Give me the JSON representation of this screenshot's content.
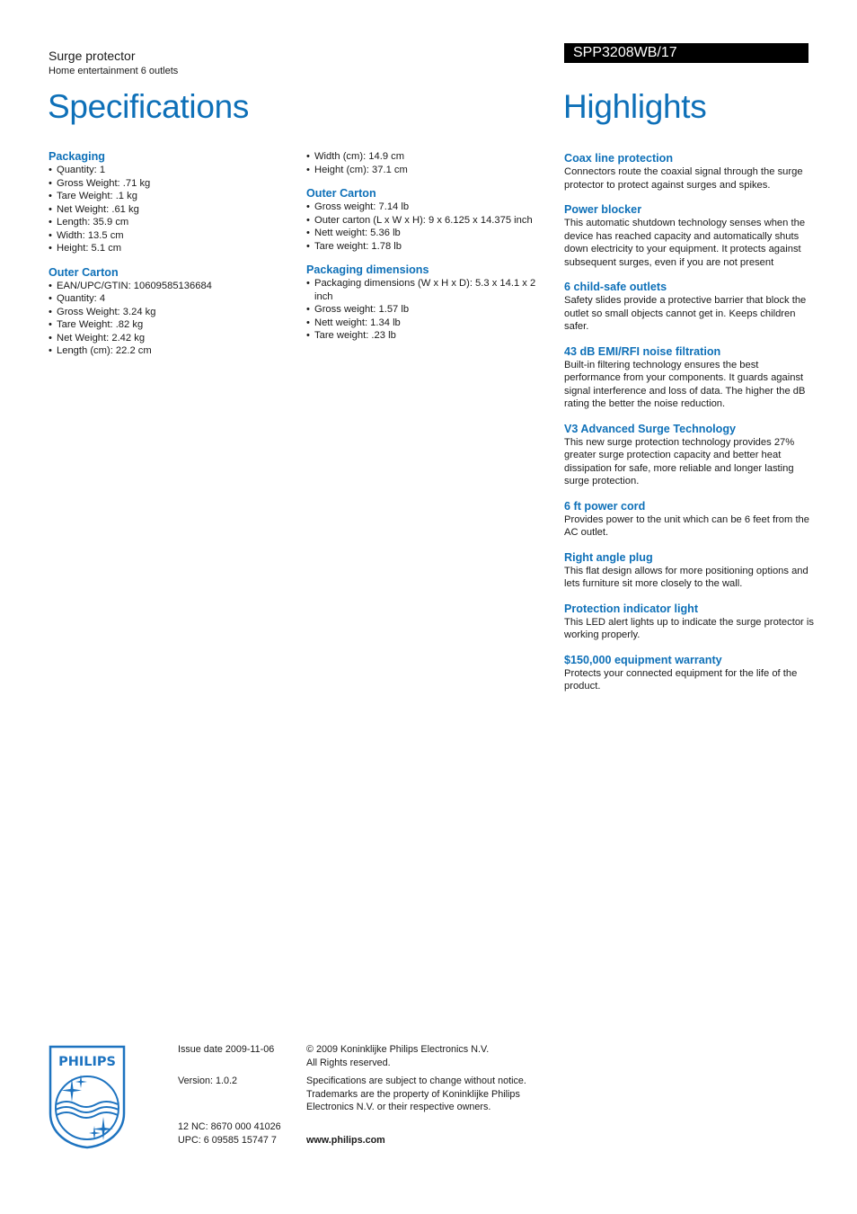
{
  "header": {
    "product_name": "Surge protector",
    "product_subtitle": "Home entertainment 6 outlets",
    "model": "SPP3208WB/17",
    "specifications_title": "Specifications",
    "highlights_title": "Highlights"
  },
  "colors": {
    "accent": "#0e70b8",
    "model_bar_bg": "#000000",
    "text": "#1a1a1a"
  },
  "specifications": {
    "column1": [
      {
        "heading": "Packaging",
        "items": [
          "Quantity: 1",
          "Gross Weight: .71 kg",
          "Tare Weight: .1 kg",
          "Net Weight: .61 kg",
          "Length: 35.9 cm",
          "Width: 13.5 cm",
          "Height: 5.1 cm"
        ]
      },
      {
        "heading": "Outer Carton",
        "items": [
          "EAN/UPC/GTIN: 10609585136684",
          "Quantity: 4",
          "Gross Weight: 3.24 kg",
          "Tare Weight: .82 kg",
          "Net Weight: 2.42 kg",
          "Length (cm): 22.2 cm"
        ]
      }
    ],
    "column2": [
      {
        "heading": "",
        "items": [
          "Width (cm): 14.9 cm",
          "Height (cm): 37.1 cm"
        ]
      },
      {
        "heading": "Outer Carton",
        "items": [
          "Gross weight: 7.14 lb",
          "Outer carton (L x W x H): 9 x 6.125 x 14.375 inch",
          "Nett weight: 5.36 lb",
          "Tare weight: 1.78 lb"
        ]
      },
      {
        "heading": "Packaging dimensions",
        "items": [
          "Packaging dimensions (W x H x D): 5.3 x 14.1 x 2 inch",
          "Gross weight: 1.57 lb",
          "Nett weight: 1.34 lb",
          "Tare weight: .23 lb"
        ]
      }
    ]
  },
  "highlights": [
    {
      "heading": "Coax line protection",
      "text": "Connectors route the coaxial signal through the surge protector to protect against surges and spikes."
    },
    {
      "heading": "Power blocker",
      "text": "This automatic shutdown technology senses when the device has reached capacity and automatically shuts down electricity to your equipment. It protects against subsequent surges, even if you are not present"
    },
    {
      "heading": "6 child-safe outlets",
      "text": "Safety slides provide a protective barrier that block the outlet so small objects cannot get in. Keeps children safer."
    },
    {
      "heading": "43 dB EMI/RFI noise filtration",
      "text": "Built-in filtering technology ensures the best performance from your components. It guards against signal interference and loss of data. The higher the dB rating the better the noise reduction."
    },
    {
      "heading": "V3 Advanced Surge Technology",
      "text": "This new surge protection technology provides 27% greater surge protection capacity and better heat dissipation for safe, more reliable and longer lasting surge protection."
    },
    {
      "heading": "6 ft power cord",
      "text": "Provides power to the unit which can be 6 feet from the AC outlet."
    },
    {
      "heading": "Right angle plug",
      "text": "This flat design allows for more positioning options and lets furniture sit more closely to the wall."
    },
    {
      "heading": "Protection indicator light",
      "text": "This LED alert lights up to indicate the surge protector is working properly."
    },
    {
      "heading": "$150,000 equipment warranty",
      "text": "Protects your connected equipment for the life of the product."
    }
  ],
  "footer": {
    "logo_text": "PHILIPS",
    "issue_date": "Issue date 2009-11-06",
    "version": "Version: 1.0.2",
    "nc": "12 NC: 8670 000 41026",
    "upc": "UPC: 6 09585 15747 7",
    "copyright_line1": "© 2009 Koninklijke Philips Electronics N.V.",
    "copyright_line2": "All Rights reserved.",
    "disclaimer": "Specifications are subject to change without notice. Trademarks are the property of Koninklijke Philips Electronics N.V. or their respective owners.",
    "website": "www.philips.com"
  }
}
